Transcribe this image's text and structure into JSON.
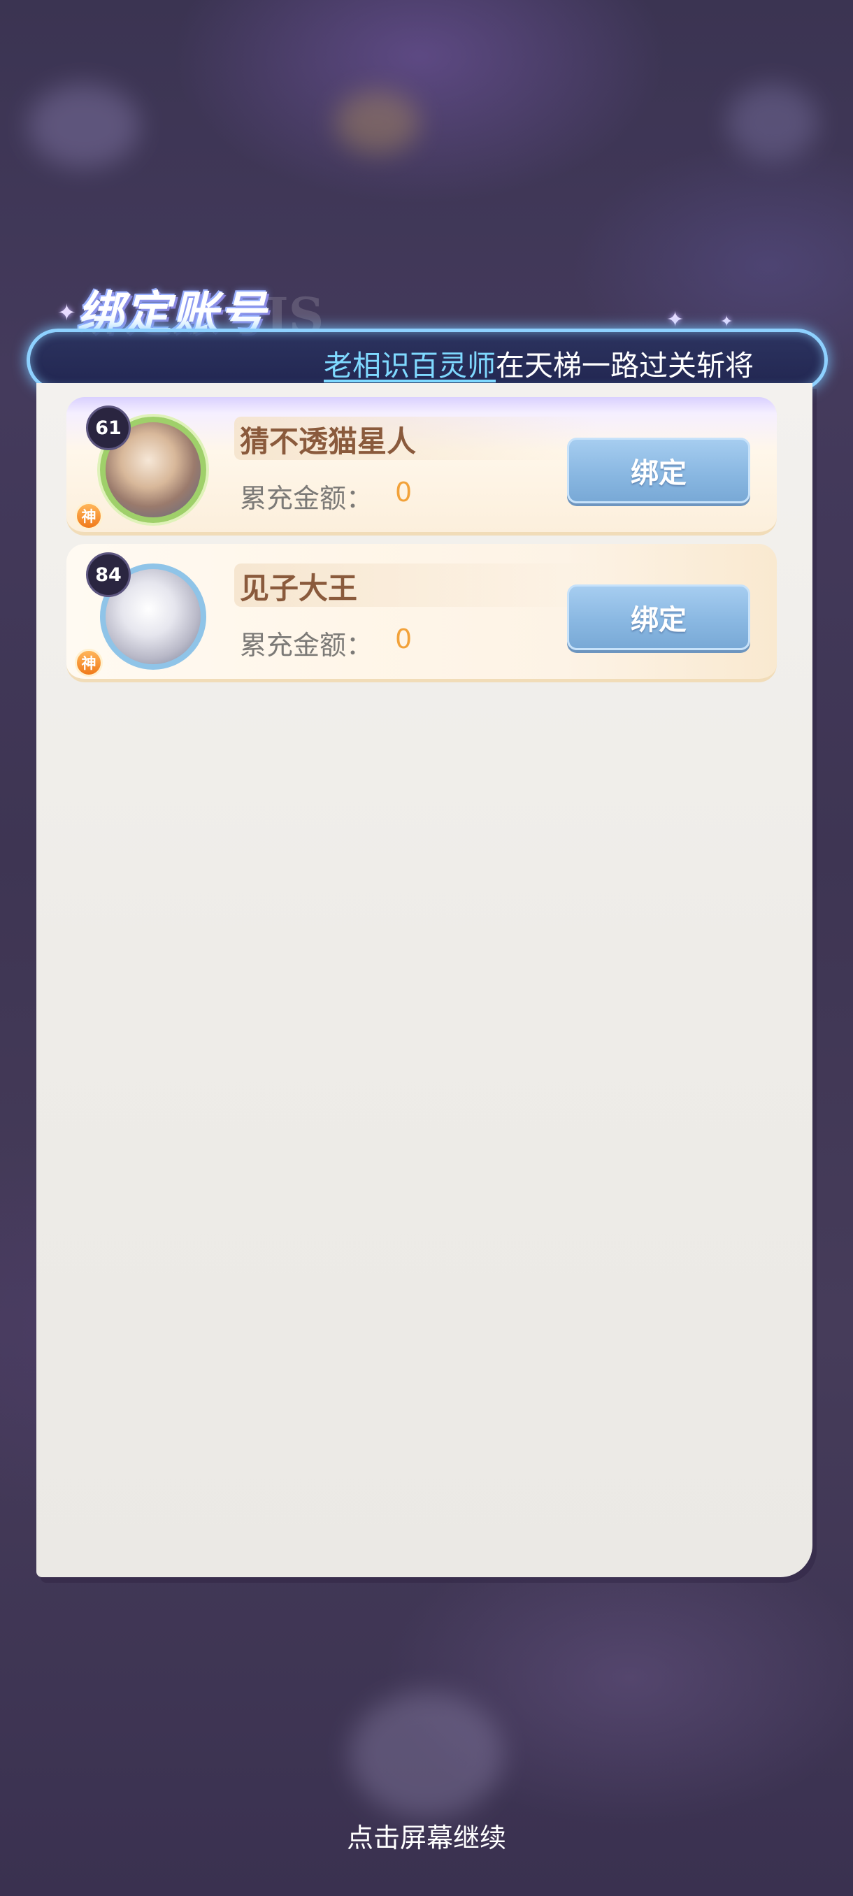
{
  "dialog": {
    "title": "绑定账号",
    "ticker": {
      "highlight": "老相识百灵师",
      "text": "在天梯一路过关斩将"
    }
  },
  "accounts": [
    {
      "level": "61",
      "tier_badge": "神",
      "name": "猜不透猫星人",
      "recharge_label": "累充金额：",
      "recharge_value": "0",
      "bind_label": "绑定"
    },
    {
      "level": "84",
      "tier_badge": "神",
      "name": "见子大王",
      "recharge_label": "累充金额：",
      "recharge_value": "0",
      "bind_label": "绑定"
    }
  ],
  "footer": {
    "continue_hint": "点击屏幕继续"
  },
  "colors": {
    "accent_blue": "#8ab8e2",
    "recharge_value": "#f2a23a",
    "name_brown": "#8a5a3c",
    "ticker_highlight": "#7fd9ff"
  }
}
